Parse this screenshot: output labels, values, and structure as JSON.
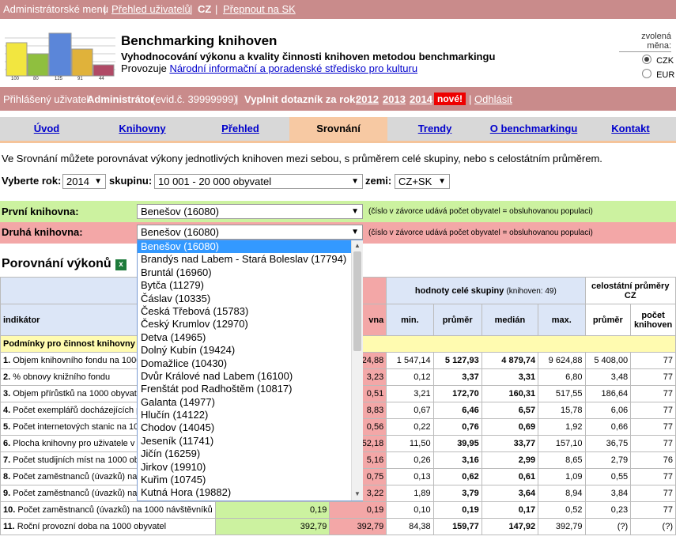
{
  "topbar": {
    "admin_menu": "Administrátorské menu",
    "users": "Přehled uživatelů",
    "cz": "CZ",
    "switch_sk": "Přepnout na SK",
    "sep": "|"
  },
  "header": {
    "title": "Benchmarking knihoven",
    "subtitle": "Vyhodnocování výkonu a kvality činnosti knihoven metodou benchmarkingu",
    "provider_prefix": "Provozuje",
    "provider_link": "Národní informační a poradenské středisko pro kulturu",
    "currency_label": "zvolená měna:",
    "currencies": [
      {
        "label": "CZK",
        "selected": true
      },
      {
        "label": "EUR",
        "selected": false
      }
    ],
    "logo_values": [
      "100",
      "80",
      "125",
      "91",
      "44"
    ],
    "logo_colors": [
      "#f2e640",
      "#8fbf3f",
      "#5b86d9",
      "#e0b23a",
      "#b04a66"
    ]
  },
  "userbar": {
    "logged_prefix": "Přihlášený uživatel:",
    "user": "Administrátor",
    "evid": "(evid.č. 39999999)",
    "fill_label": "Vyplnit dotazník za rok:",
    "years": [
      "2012",
      "2013",
      "2014"
    ],
    "new_badge": "nové!",
    "logout": "Odhlásit"
  },
  "nav": {
    "tabs": [
      "Úvod",
      "Knihovny",
      "Přehled",
      "Srovnání",
      "Trendy",
      "O benchmarkingu",
      "Kontakt"
    ],
    "active": "Srovnání"
  },
  "intro": "Ve Srovnání můžete porovnávat výkony jednotlivých knihoven mezi sebou, s průměrem celé skupiny, nebo s celostátním průměrem.",
  "filters": {
    "year_label": "Vyberte rok:",
    "year": "2014",
    "group_label": "skupinu:",
    "group": "10 001 - 20 000 obyvatel",
    "country_label": "zemi:",
    "country": "CZ+SK"
  },
  "first": {
    "label": "První knihovna:",
    "value": "Benešov (16080)",
    "note": "(číslo v závorce udává počet obyvatel = obsluhovanou populaci)"
  },
  "second": {
    "label": "Druhá knihovna:",
    "value": "Benešov (16080)",
    "note": "(číslo v závorce udává počet obyvatel = obsluhovanou populaci)"
  },
  "dropdown": [
    "Benešov (16080)",
    "Brandýs nad Labem - Stará Boleslav (17794)",
    "Bruntál (16960)",
    "Bytča (11279)",
    "Čáslav (10335)",
    "Česká Třebová (15783)",
    "Český Krumlov (12970)",
    "Detva (14965)",
    "Dolný Kubín (19424)",
    "Domažlice (10430)",
    "Dvůr Králové nad Labem (16100)",
    "Frenštát pod Radhoštěm (10817)",
    "Galanta (14977)",
    "Hlučín (14122)",
    "Chodov (14045)",
    "Jeseník (11741)",
    "Jičín (16259)",
    "Jirkov (19910)",
    "Kuřim (10745)",
    "Kutná Hora (19882)"
  ],
  "section": {
    "title": "Porovnání výkonů"
  },
  "table": {
    "group_header": "hodnoty celé skupiny",
    "group_count": "(knihoven: 49)",
    "national_header": "celostátní průměry CZ",
    "cols": [
      "min.",
      "průměr",
      "medián",
      "max.",
      "průměr",
      "počet knihoven"
    ],
    "indicator": "indikátor",
    "second_col": "vna",
    "category": "Podmínky pro činnost knihovny",
    "rows": [
      {
        "n": "1.",
        "label": "Objem knihovního fondu na 1000",
        "v2": "24,88",
        "min": "1 547,14",
        "avg": "5 127,93",
        "med": "4 879,74",
        "max": "9 624,88",
        "cz": "5 408,00",
        "cnt": "77"
      },
      {
        "n": "2.",
        "label": "% obnovy knižního fondu",
        "v2": "3,23",
        "min": "0,12",
        "avg": "3,37",
        "med": "3,31",
        "max": "6,80",
        "cz": "3,48",
        "cnt": "77"
      },
      {
        "n": "3.",
        "label": "Objem přírůstků na 1000 obyvate",
        "v2": "0,51",
        "min": "3,21",
        "avg": "172,70",
        "med": "160,31",
        "max": "517,55",
        "cz": "186,64",
        "cnt": "77"
      },
      {
        "n": "4.",
        "label": "Počet exemplářů docházejících p",
        "v2": "8,83",
        "min": "0,67",
        "avg": "6,46",
        "med": "6,57",
        "max": "15,78",
        "cz": "6,06",
        "cnt": "77"
      },
      {
        "n": "5.",
        "label": "Počet internetových stanic na 10",
        "v2": "0,56",
        "min": "0,22",
        "avg": "0,76",
        "med": "0,69",
        "max": "1,92",
        "cz": "0,66",
        "cnt": "77"
      },
      {
        "n": "6.",
        "label": "Plocha knihovny pro uživatele v m",
        "v2": "52,18",
        "min": "11,50",
        "avg": "39,95",
        "med": "33,77",
        "max": "157,10",
        "cz": "36,75",
        "cnt": "77"
      },
      {
        "n": "7.",
        "label": "Počet studijních míst na 1000 oby",
        "v2": "5,16",
        "min": "0,26",
        "avg": "3,16",
        "med": "2,99",
        "max": "8,65",
        "cz": "2,79",
        "cnt": "76"
      },
      {
        "n": "8.",
        "label": "Počet zaměstnanců (úvazků) na 1",
        "v2": "0,75",
        "min": "0,13",
        "avg": "0,62",
        "med": "0,61",
        "max": "1,09",
        "cz": "0,55",
        "cnt": "77"
      },
      {
        "n": "9.",
        "label": "Počet zaměstnanců (úvazků) na 1",
        "v2": "3,22",
        "min": "1,89",
        "avg": "3,79",
        "med": "3,64",
        "max": "8,94",
        "cz": "3,84",
        "cnt": "77"
      },
      {
        "n": "10.",
        "label": "Počet zaměstnanců (úvazků) na 1000 návštěvníků",
        "v1": "0,19",
        "v2": "0,19",
        "min": "0,10",
        "avg": "0,19",
        "med": "0,17",
        "max": "0,52",
        "cz": "0,23",
        "cnt": "77"
      },
      {
        "n": "11.",
        "label": "Roční provozní doba na 1000 obyvatel",
        "v1": "392,79",
        "v2": "392,79",
        "min": "84,38",
        "avg": "159,77",
        "med": "147,92",
        "max": "392,79",
        "cz": "(?)",
        "cnt": "(?)"
      }
    ]
  }
}
